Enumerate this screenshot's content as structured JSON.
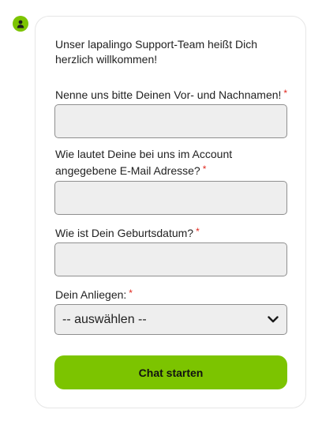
{
  "colors": {
    "accent": "#7cc400",
    "required": "#e0281e",
    "input_bg": "#eeeeee",
    "input_border": "#8f8f8f"
  },
  "icons": {
    "avatar": "user-icon",
    "select": "chevron-down-icon"
  },
  "chat": {
    "welcome": "Unser lapalingo Support-Team heißt Dich herzlich willkommen!",
    "required_marker": "*"
  },
  "form": {
    "name": {
      "label": "Nenne uns bitte Deinen Vor- und Nachnamen!",
      "value": ""
    },
    "email": {
      "label": "Wie lautet Deine bei uns im Account angegebene E-Mail Adresse?",
      "value": ""
    },
    "birthdate": {
      "label": "Wie ist Dein Geburtsdatum?",
      "value": ""
    },
    "concern": {
      "label": "Dein Anliegen:",
      "selected": "-- auswählen --"
    },
    "submit_label": "Chat starten"
  }
}
